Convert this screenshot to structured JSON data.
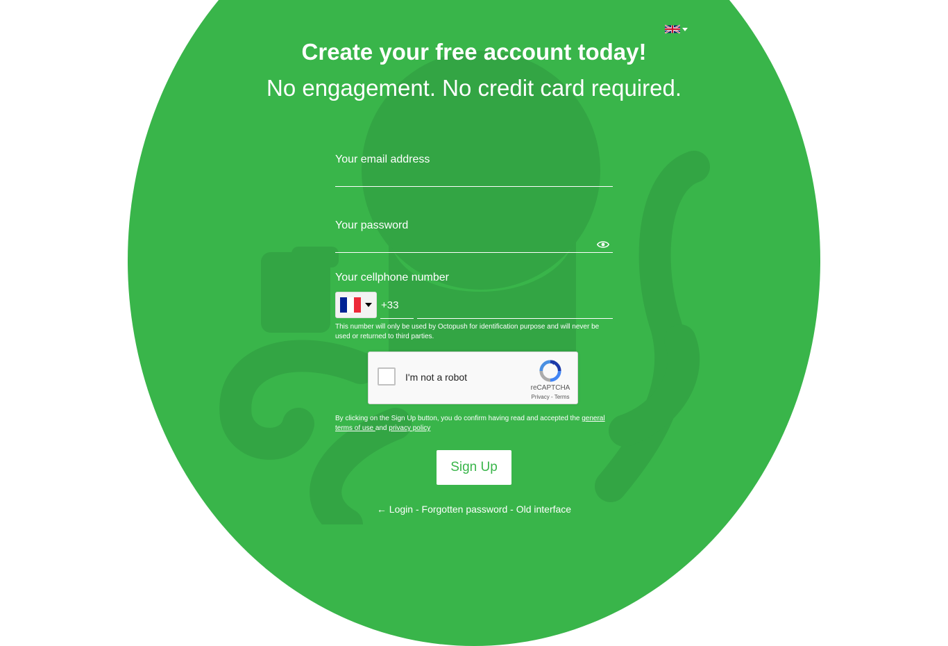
{
  "header": {
    "title": "Create your free account today!",
    "subtitle": "No engagement. No credit card required.",
    "language_icon": "uk-flag-icon"
  },
  "form": {
    "email": {
      "label": "Your email address",
      "value": ""
    },
    "password": {
      "label": "Your password",
      "value": "",
      "toggle_icon": "eye-icon"
    },
    "phone": {
      "label": "Your cellphone number",
      "country_icon": "france-flag-icon",
      "dial_code": "+33",
      "value": "",
      "note": "This number will only be used by Octopush for identification purpose and will never be used or returned to third parties."
    },
    "captcha": {
      "label": "I'm not a robot",
      "brand": "reCAPTCHA",
      "privacy": "Privacy",
      "separator": " - ",
      "terms": "Terms"
    },
    "legal": {
      "prefix": "By clicking on the Sign Up button, you do confirm having read and accepted the ",
      "terms_link": "general terms of use ",
      "conjunction": "and ",
      "privacy_link": "privacy policy"
    },
    "submit_label": "Sign Up"
  },
  "footer": {
    "login": "← Login",
    "sep1": " - ",
    "forgot": "Forgotten password",
    "sep2": " - ",
    "old": "Old interface"
  },
  "colors": {
    "brand_green": "#39b54a",
    "deco_green": "#33a544"
  }
}
